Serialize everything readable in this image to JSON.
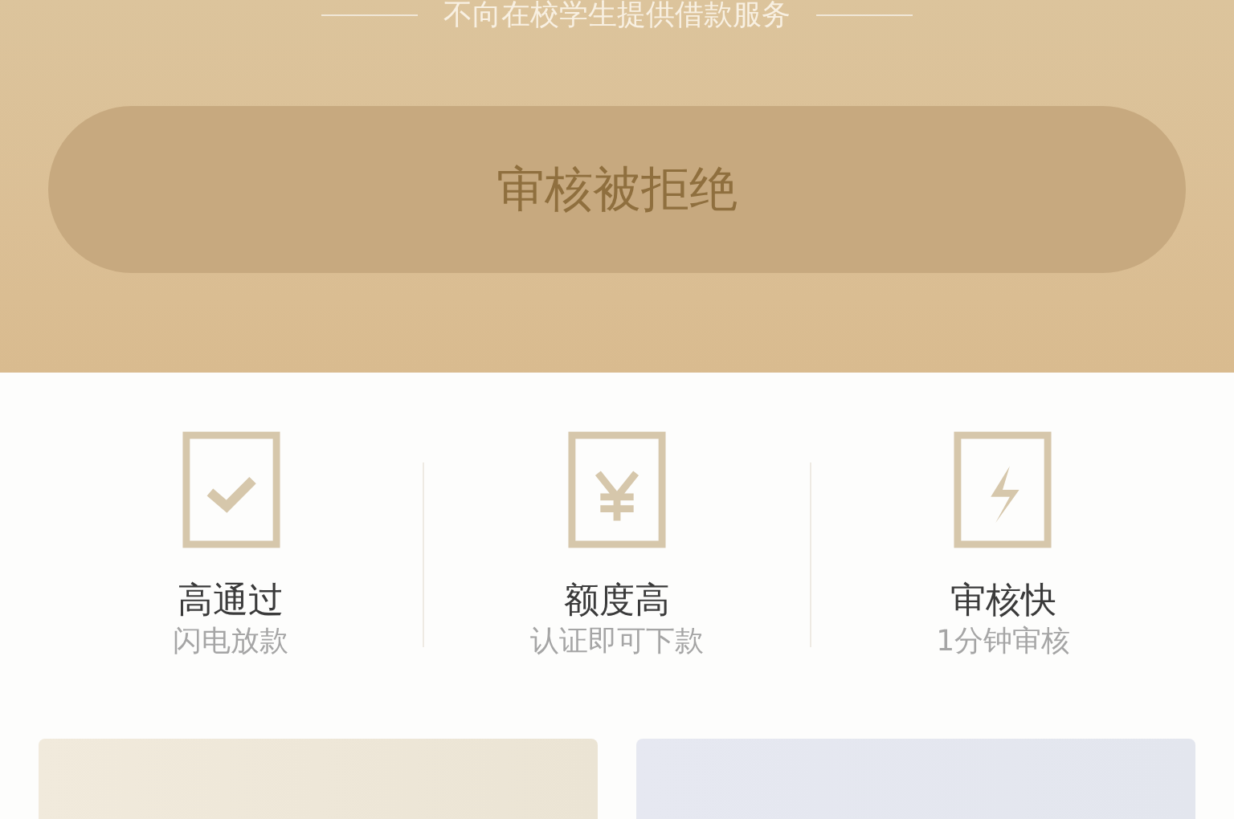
{
  "banner": {
    "notice": "不向在校学生提供借款服务",
    "button": {
      "label": "审核被拒绝",
      "disabled": true
    }
  },
  "features": [
    {
      "kind": "check",
      "title": "高通过",
      "subtitle": "闪电放款"
    },
    {
      "kind": "yen",
      "title": "额度高",
      "subtitle": "认证即可下款"
    },
    {
      "kind": "bolt",
      "title": "审核快",
      "subtitle": "1分钟审核"
    }
  ],
  "cards": [
    {
      "kind": "warm"
    },
    {
      "kind": "cool"
    }
  ]
}
